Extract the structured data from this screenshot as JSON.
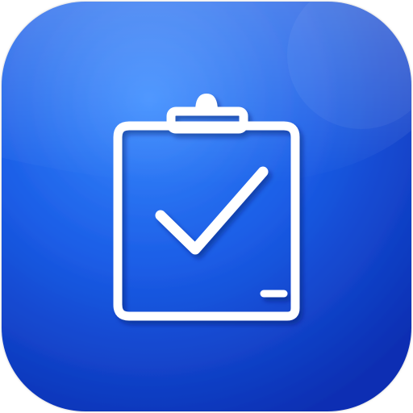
{
  "app_icon": {
    "icon": "clipboard-check-icon",
    "colors": {
      "background_light": "#3b8cff",
      "background_mid": "#1b5de6",
      "background_dark": "#0b2fb3",
      "glyph": "#ffffff"
    }
  }
}
